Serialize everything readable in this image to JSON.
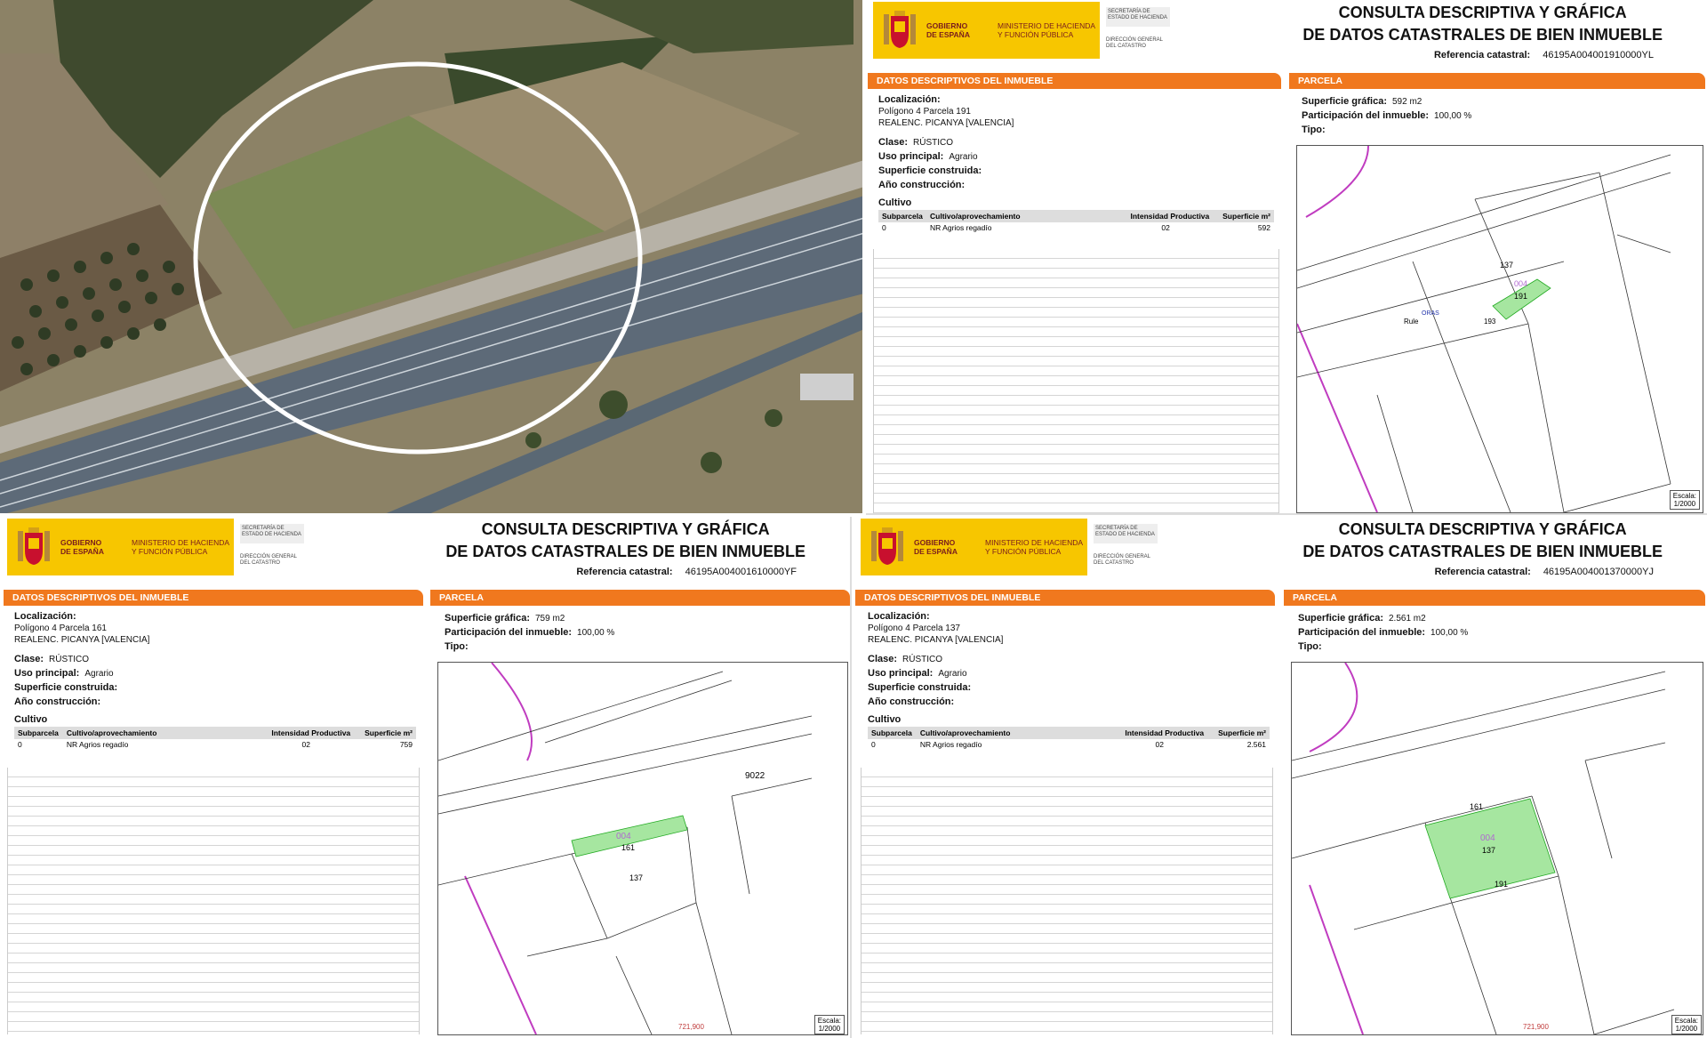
{
  "header": {
    "gobierno": "GOBIERNO DE ESPAÑA",
    "ministerio": "MINISTERIO DE HACIENDA Y FUNCIÓN PÚBLICA",
    "secretaria": "SECRETARÍA DE ESTADO DE HACIENDA",
    "direccion": "DIRECCIÓN GENERAL DEL CATASTRO",
    "title1": "CONSULTA DESCRIPTIVA Y GRÁFICA",
    "title2": "DE DATOS CATASTRALES DE BIEN INMUEBLE",
    "ref_label": "Referencia catastral:"
  },
  "labels": {
    "datos": "DATOS DESCRIPTIVOS DEL INMUEBLE",
    "parcela": "PARCELA",
    "localizacion": "Localización:",
    "clase": "Clase:",
    "uso": "Uso principal:",
    "sup_construida": "Superficie construida:",
    "anio": "Año construcción:",
    "cultivo": "Cultivo",
    "subparcela": "Subparcela",
    "cultivo_aprov": "Cultivo/aprovechamiento",
    "intensidad": "Intensidad Productiva",
    "superficie_m2": "Superficie m²",
    "sup_grafica": "Superficie gráfica:",
    "participacion": "Participación del inmueble:",
    "tipo": "Tipo:",
    "escala": "Escala:"
  },
  "docs": [
    {
      "ref": "46195A004001910000YL",
      "loc1": "Polígono 4 Parcela 191",
      "loc2": "REALENC. PICANYA [VALENCIA]",
      "clase": "RÚSTICO",
      "uso": "Agrario",
      "cult_sub": "0",
      "cult_name": "NR Agrios regadío",
      "cult_int": "02",
      "cult_sup": "592",
      "sup_grafica": "592 m2",
      "participacion": "100,00 %",
      "escala": "1/2000",
      "map_labels": [
        "137",
        "004",
        "191",
        "193",
        "Rule",
        "ORAS"
      ]
    },
    {
      "ref": "46195A004001610000YF",
      "loc1": "Polígono 4 Parcela 161",
      "loc2": "REALENC. PICANYA [VALENCIA]",
      "clase": "RÚSTICO",
      "uso": "Agrario",
      "cult_sub": "0",
      "cult_name": "NR Agrios regadío",
      "cult_int": "02",
      "cult_sup": "759",
      "sup_grafica": "759 m2",
      "participacion": "100,00 %",
      "escala": "1/2000",
      "map_labels": [
        "9022",
        "004",
        "161",
        "137",
        "721,900"
      ]
    },
    {
      "ref": "46195A004001370000YJ",
      "loc1": "Polígono 4 Parcela 137",
      "loc2": "REALENC. PICANYA [VALENCIA]",
      "clase": "RÚSTICO",
      "uso": "Agrario",
      "cult_sub": "0",
      "cult_name": "NR Agrios regadío",
      "cult_int": "02",
      "cult_sup": "2.561",
      "sup_grafica": "2.561 m2",
      "participacion": "100,00 %",
      "escala": "1/2000",
      "map_labels": [
        "161",
        "004",
        "137",
        "191",
        "721,900"
      ]
    }
  ]
}
